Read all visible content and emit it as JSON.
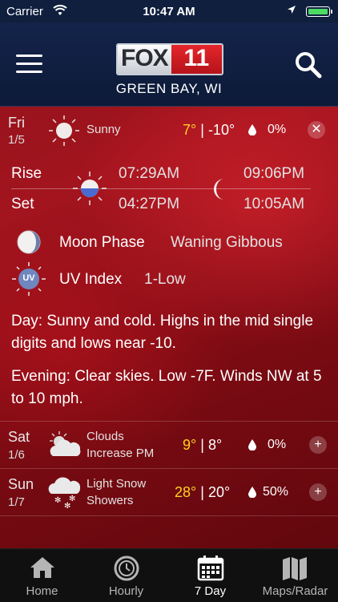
{
  "status": {
    "carrier": "Carrier",
    "time": "10:47 AM"
  },
  "header": {
    "station_fox": "FOX",
    "station_num": "11",
    "city": "GREEN BAY, WI"
  },
  "today": {
    "day": "Fri",
    "date": "1/5",
    "condition": "Sunny",
    "high": "7°",
    "low": "-10°",
    "precip": "0%",
    "rise_label": "Rise",
    "set_label": "Set",
    "sunrise": "07:29AM",
    "sunset": "04:27PM",
    "moonrise": "09:06PM",
    "moonset": "10:05AM",
    "moon_phase_label": "Moon Phase",
    "moon_phase_value": "Waning Gibbous",
    "uv_label": "UV Index",
    "uv_value": "1-Low",
    "uv_icon_text": "UV",
    "day_text": "Day: Sunny and cold. Highs in the mid single digits and lows near -10.",
    "evening_text": "Evening: Clear skies. Low -7F. Winds NW at 5 to 10 mph."
  },
  "forecast": [
    {
      "day": "Sat",
      "date": "1/6",
      "condition_line1": "Clouds",
      "condition_line2": "Increase PM",
      "high": "9°",
      "low": "8°",
      "precip": "0%"
    },
    {
      "day": "Sun",
      "date": "1/7",
      "condition_line1": "Light Snow",
      "condition_line2": "Showers",
      "high": "28°",
      "low": "20°",
      "precip": "50%"
    }
  ],
  "tabs": [
    {
      "label": "Home",
      "icon": "home-icon"
    },
    {
      "label": "Hourly",
      "icon": "clock-icon"
    },
    {
      "label": "7 Day",
      "icon": "calendar-icon",
      "active": true
    },
    {
      "label": "Maps/Radar",
      "icon": "map-icon"
    }
  ],
  "colors": {
    "header": "#0f1f3d",
    "high_temp": "#ffd21f",
    "battery": "#4cd964",
    "accent": "#e4262b"
  }
}
